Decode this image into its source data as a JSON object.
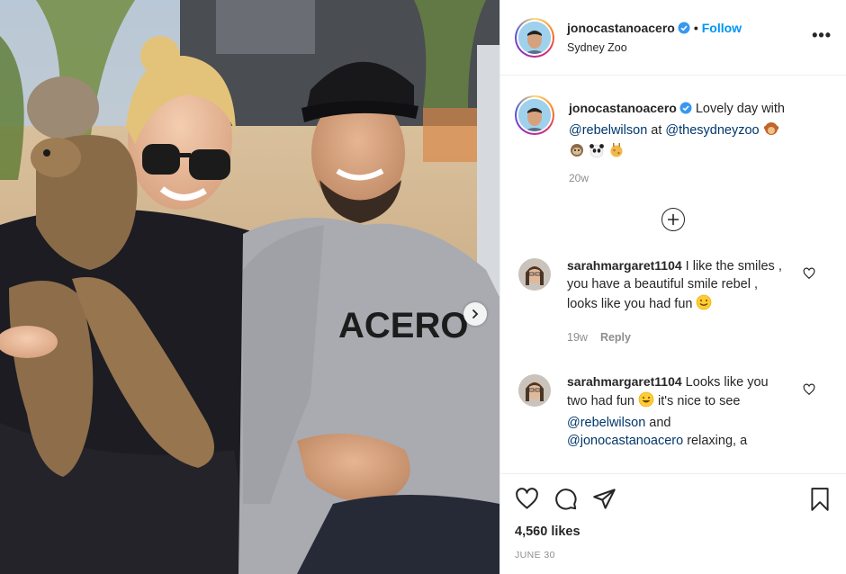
{
  "post": {
    "username": "jonocastanoacero",
    "follow_label": "Follow",
    "dot": "•",
    "location": "Sydney Zoo",
    "more_label": "•••",
    "photo": {
      "shirt_text": "ACERO"
    },
    "caption": {
      "username": "jonocastanoacero",
      "text_before": " Lovely day with ",
      "mention1": "@rebelwilson",
      "text_middle": " at ",
      "mention2": "@thesydneyzoo",
      "time": "20w"
    },
    "comments": [
      {
        "username": "sarahmargaret1104",
        "text": " I like the smiles , you have a beautiful smile rebel , looks like you had fun ",
        "time": "19w",
        "reply_label": "Reply"
      },
      {
        "username": "sarahmargaret1104",
        "text_before": " Looks like you two had fun ",
        "text_middle": " it's nice to see ",
        "mention1": "@rebelwilson",
        "text_and": " and ",
        "mention2": "@jonocastanoacero",
        "text_after": " relaxing, a"
      }
    ],
    "likes": "4,560 likes",
    "date": "JUNE 30"
  },
  "colors": {
    "link": "#00376b",
    "follow": "#0095f6",
    "verified": "#3897f0",
    "muted": "#8e8e8e"
  }
}
